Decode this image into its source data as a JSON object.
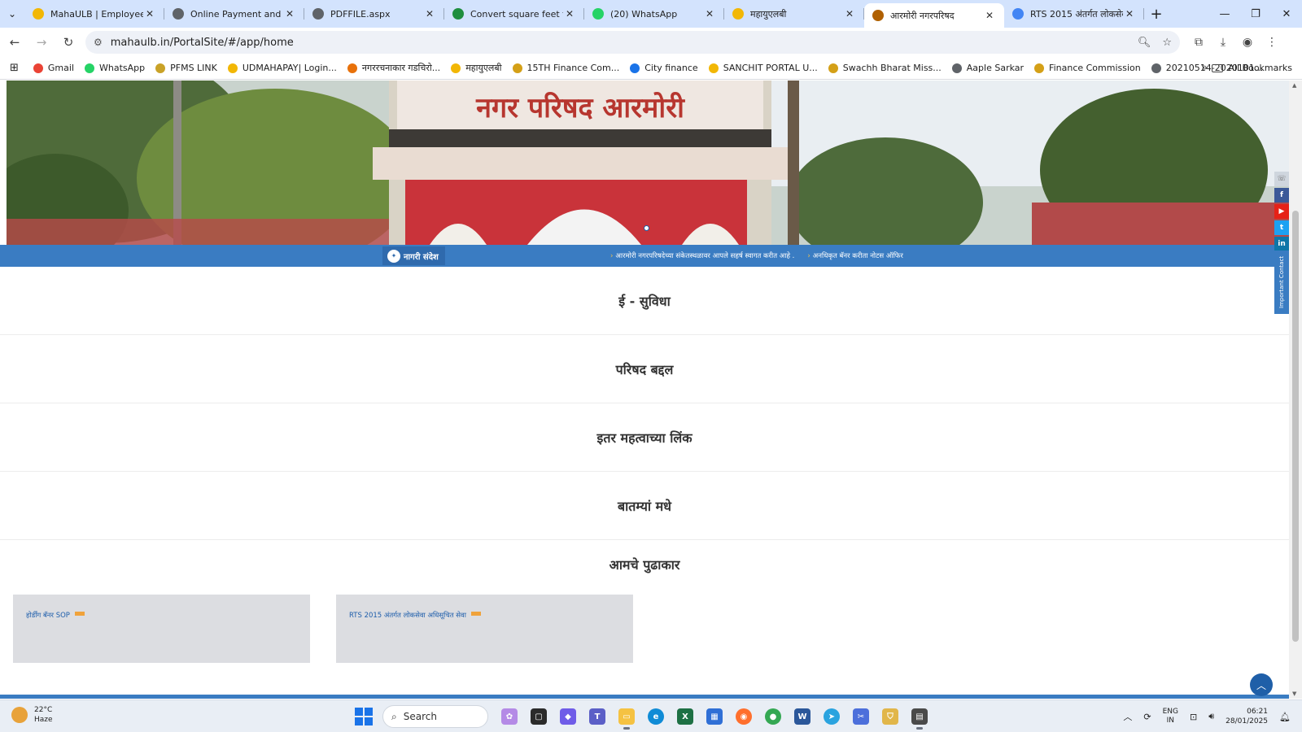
{
  "browser": {
    "tabs": [
      {
        "title": "MahaULB | Employee Mo",
        "color": "#f2b705"
      },
      {
        "title": "Online Payment and Cou",
        "color": "#5f6368"
      },
      {
        "title": "PDFFILE.aspx",
        "color": "#5f6368"
      },
      {
        "title": "Convert square feet to sq",
        "color": "#1e8e3e"
      },
      {
        "title": "(20) WhatsApp",
        "color": "#25d366"
      },
      {
        "title": "महायुएलबी",
        "color": "#f2b705"
      },
      {
        "title": "आरमोरी नगरपरिषद",
        "color": "#b06000",
        "active": true
      },
      {
        "title": "RTS 2015 अंतर्गत लोकसेवा",
        "color": "#4285f4"
      }
    ],
    "url": "mahaulb.in/PortalSite/#/app/home",
    "bookmarks": [
      {
        "label": "Gmail",
        "color": "#ea4335"
      },
      {
        "label": "WhatsApp",
        "color": "#25d366"
      },
      {
        "label": "PFMS LINK",
        "color": "#c9a227"
      },
      {
        "label": "UDMAHAPAY| Login...",
        "color": "#f2b705"
      },
      {
        "label": "नगररचनाकार गडचिरो...",
        "color": "#e8710a"
      },
      {
        "label": "महायुएलबी",
        "color": "#f2b705"
      },
      {
        "label": "15TH Finance Com...",
        "color": "#d4a017"
      },
      {
        "label": "City finance",
        "color": "#1a73e8"
      },
      {
        "label": "SANCHIT PORTAL U...",
        "color": "#f2b705"
      },
      {
        "label": "Swachh Bharat Miss...",
        "color": "#d4a017"
      },
      {
        "label": "Aaple Sarkar",
        "color": "#5f6368"
      },
      {
        "label": "Finance Commission",
        "color": "#d4a017"
      },
      {
        "label": "20210514-2020101...",
        "color": "#5f6368"
      }
    ],
    "all_bookmarks": "All Bookmarks"
  },
  "page": {
    "hero_sign": "नगर परिषद आरमोरी",
    "ticker_label": "नागरी संदेश",
    "ticker_items": [
      "आरमोरी नगरपरिषदेच्या संकेतस्थळावर आपले सहर्ष स्वागत करीत आहे .",
      "अनधिकृत बॅनर करीता नोटस ऑफिर"
    ],
    "important_contact": "Important Contact",
    "sections": [
      "ई - सुविधा",
      "परिषद बद्दल",
      "इतर महत्वाच्या लिंक",
      "बातम्यां मधे",
      "आमचे पुढाकार"
    ],
    "cards": [
      {
        "link": "होर्डींग बॅनर SOP"
      },
      {
        "link": "RTS 2015 अंतर्गत लोकसेवा अधिसूचित सेवा"
      }
    ]
  },
  "taskbar": {
    "temperature": "22°C",
    "weather": "Haze",
    "search_label": "Search",
    "lang_top": "ENG",
    "lang_bottom": "IN",
    "time": "06:21",
    "date": "28/01/2025"
  }
}
